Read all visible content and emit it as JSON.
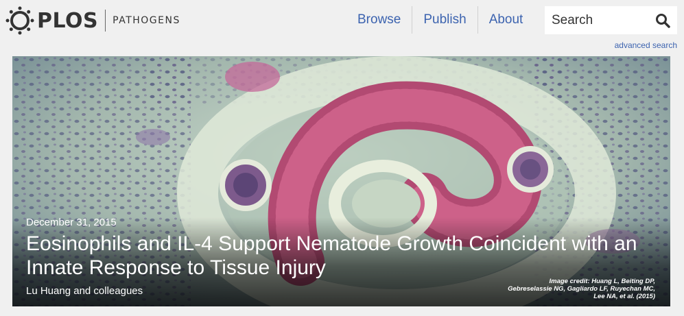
{
  "brand": {
    "name": "PLOS",
    "journal": "PATHOGENS"
  },
  "nav": {
    "items": [
      "Browse",
      "Publish",
      "About"
    ]
  },
  "search": {
    "placeholder": "Search",
    "advanced_label": "advanced search",
    "icon": "search-icon"
  },
  "feature": {
    "date": "December 31, 2015",
    "title": "Eosinophils and IL-4 Support Nematode Growth Coincident with an Innate Response to Tissue Injury",
    "authors": "Lu Huang and colleagues",
    "image_credit": "Image credit: Huang L, Beiting DP, Gebreselassie NG, Gagliardo LF, Ruyechan MC, Lee NA, et al. (2015)"
  },
  "colors": {
    "link": "#3c63af",
    "background": "#f0f0f0",
    "logo_text": "#333333"
  }
}
